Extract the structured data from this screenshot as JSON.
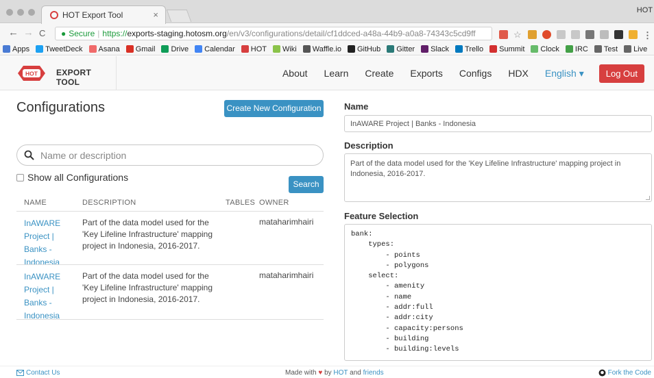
{
  "browser": {
    "tab_title": "HOT Export Tool",
    "tab_close": "×",
    "profile": "HOT",
    "secure_label": "Secure",
    "url_scheme": "https://",
    "url_host": "exports-staging.hotosm.org",
    "url_path": "/en/v3/configurations/detail/cf1ddced-a48a-44b9-a0a8-74343c5cd9ff",
    "back_glyph": "←",
    "forward_glyph": "→",
    "reload_glyph": "C",
    "bookmarks": [
      {
        "label": "Apps",
        "color": "#4a7bd4"
      },
      {
        "label": "TweetDeck",
        "color": "#1da1f2"
      },
      {
        "label": "Asana",
        "color": "#f06a6a"
      },
      {
        "label": "Gmail",
        "color": "#d93025"
      },
      {
        "label": "Drive",
        "color": "#0f9d58"
      },
      {
        "label": "Calendar",
        "color": "#4285f4"
      },
      {
        "label": "HOT",
        "color": "#d73f3f"
      },
      {
        "label": "Wiki",
        "color": "#8bc34a"
      },
      {
        "label": "Waffle.io",
        "color": "#555555"
      },
      {
        "label": "GitHub",
        "color": "#222222"
      },
      {
        "label": "Gitter",
        "color": "#2b7a78"
      },
      {
        "label": "Slack",
        "color": "#611f69"
      },
      {
        "label": "Trello",
        "color": "#0079bf"
      },
      {
        "label": "Summit",
        "color": "#d32f2f"
      },
      {
        "label": "Clock",
        "color": "#66bb6a"
      },
      {
        "label": "IRC",
        "color": "#43a047"
      },
      {
        "label": "Test",
        "color": "#666666"
      },
      {
        "label": "Live",
        "color": "#666666"
      }
    ]
  },
  "nav": {
    "brand_logo_text": "HOT",
    "brand": "EXPORT TOOL",
    "links": [
      "About",
      "Learn",
      "Create",
      "Exports",
      "Configs",
      "HDX"
    ],
    "language": "English ▾",
    "logout": "Log Out"
  },
  "list": {
    "title": "Configurations",
    "create_button": "Create New Configuration",
    "search_placeholder": "Name or description",
    "show_all_label": "Show all Configurations",
    "search_button": "Search",
    "columns": [
      "NAME",
      "DESCRIPTION",
      "TABLES",
      "OWNER"
    ],
    "rows": [
      {
        "name": "InAWARE Project | Banks - Indonesia",
        "description": "Part of the data model used for the 'Key Lifeline Infrastructure' mapping project in Indonesia, 2016-2017.",
        "tables": "",
        "owner": "mataharimhairi"
      },
      {
        "name": "InAWARE Project | Banks - Indonesia",
        "description": "Part of the data model used for the 'Key Lifeline Infrastructure' mapping project in Indonesia, 2016-2017.",
        "tables": "",
        "owner": "mataharimhairi"
      }
    ]
  },
  "detail": {
    "name_label": "Name",
    "name_value": "InAWARE Project | Banks - Indonesia",
    "description_label": "Description",
    "description_value": "Part of the data model used for the 'Key Lifeline Infrastructure' mapping project in Indonesia, 2016-2017.",
    "feature_label": "Feature Selection",
    "feature_lines": [
      "bank:",
      "    types:",
      "        - points",
      "        - polygons",
      "    select:",
      "        - amenity",
      "        - name",
      "        - addr:full",
      "        - addr:city",
      "        - capacity:persons",
      "        - building",
      "        - building:levels"
    ]
  },
  "footer": {
    "contact": "Contact Us",
    "made_with": "Made with",
    "heart": "♥",
    "by": "by",
    "hot": "HOT",
    "and": "and",
    "friends": "friends",
    "fork": "Fork the Code"
  },
  "colors": {
    "brand_red": "#d73f3f",
    "primary_blue": "#3a92c3"
  }
}
